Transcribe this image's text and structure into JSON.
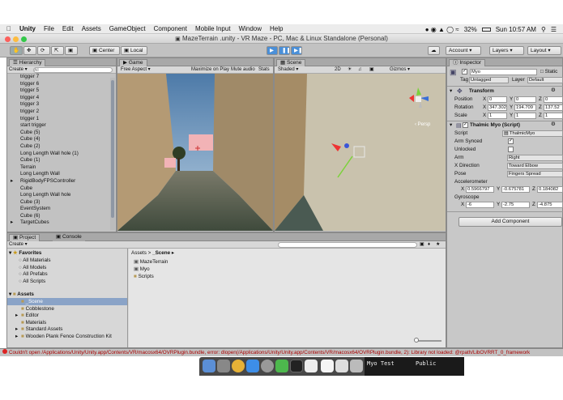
{
  "menubar": {
    "app": "Unity",
    "items": [
      "File",
      "Edit",
      "Assets",
      "GameObject",
      "Component",
      "Mobile Input",
      "Window",
      "Help"
    ],
    "battery": "32%",
    "clock": "Sun 10:57 AM"
  },
  "window_title": "MazeTerrain .unity - VR Maze - PC, Mac & Linux Standalone (Personal)",
  "toolbar": {
    "pivot": "Center",
    "space": "Local",
    "account": "Account",
    "layers": "Layers",
    "layout": "Layout"
  },
  "hierarchy": {
    "tab": "Hierarchy",
    "create": "Create",
    "search_placeholder": "All",
    "items": [
      "trigger 7",
      "trigger 6",
      "trigger 5",
      "trigger 4",
      "trigger 3",
      "trigger 2",
      "trigger 1",
      "start trigger",
      "Cube (5)",
      "Cube (4)",
      "Cube (2)",
      "Long Length Wall hole (1)",
      "Cube (1)",
      "Terrain",
      "Long Length Wall",
      "RigidBodyFPSController",
      "Cube",
      "Long Length Wall hole",
      "Cube (3)",
      "EventSystem",
      "Cube (6)",
      "TargetCubes"
    ]
  },
  "game": {
    "tab": "Game",
    "aspect": "Free Aspect",
    "maximize": "Maximize on Play",
    "mute": "Mute audio",
    "stats": "Stats"
  },
  "scene": {
    "tab": "Scene",
    "shading": "Shaded",
    "mode2d": "2D",
    "gizmos": "Gizmos",
    "persp": "Persp"
  },
  "inspector": {
    "tab": "Inspector",
    "object_name": "Myo",
    "static": "Static",
    "tag_label": "Tag",
    "tag": "Untagged",
    "layer_label": "Layer",
    "layer": "Default",
    "transform": {
      "title": "Transform",
      "position": {
        "label": "Position",
        "x": "0",
        "y": "0",
        "z": "0"
      },
      "rotation": {
        "label": "Rotation",
        "x": "347.302",
        "y": "194.709",
        "z": "137.52"
      },
      "scale": {
        "label": "Scale",
        "x": "1",
        "y": "1",
        "z": "1"
      }
    },
    "myo": {
      "title": "Thalmic Myo (Script)",
      "script_label": "Script",
      "script": "ThalmicMyo",
      "arm_synced": "Arm Synced",
      "unlocked": "Unlocked",
      "arm_label": "Arm",
      "arm": "Right",
      "xdir_label": "X Direction",
      "xdir": "Toward Elbow",
      "pose_label": "Pose",
      "pose": "Fingers Spread",
      "accel_label": "Accelerometer",
      "accel": {
        "x": "0.5966797",
        "y": "-0.675781",
        "z": "0.184082"
      },
      "gyro_label": "Gyroscope",
      "gyro": {
        "x": "-6",
        "y": "-2.75",
        "z": "-4.875"
      }
    },
    "add_component": "Add Component"
  },
  "project": {
    "tab": "Project",
    "console_tab": "Console",
    "create": "Create",
    "favorites": "Favorites",
    "fav_items": [
      "All Materials",
      "All Models",
      "All Prefabs",
      "All Scripts"
    ],
    "assets": "Assets",
    "asset_items": [
      "_Scene",
      "Cobblestone",
      "Editor",
      "Materials",
      "Standard Assets",
      "Wooden Plank Fence Construction Kit"
    ],
    "breadcrumb_root": "Assets",
    "breadcrumb_sep": ">",
    "breadcrumb_leaf": "_Scene",
    "files": [
      "MazeTerrain",
      "Myo",
      "Scripts"
    ]
  },
  "status": "Couldn't open /Applications/Unity/Unity.app/Contents/VR/macosx64/OVRPlugin.bundle, error: dlopen(/Applications/Unity/Unity.app/Contents/VR/macosx64/OVRPlugin.bundle, 2): Library not loaded: @rpath/LibOVRRT_0_framework",
  "dock": {
    "text1": "Myo Test",
    "text2": "Public"
  }
}
